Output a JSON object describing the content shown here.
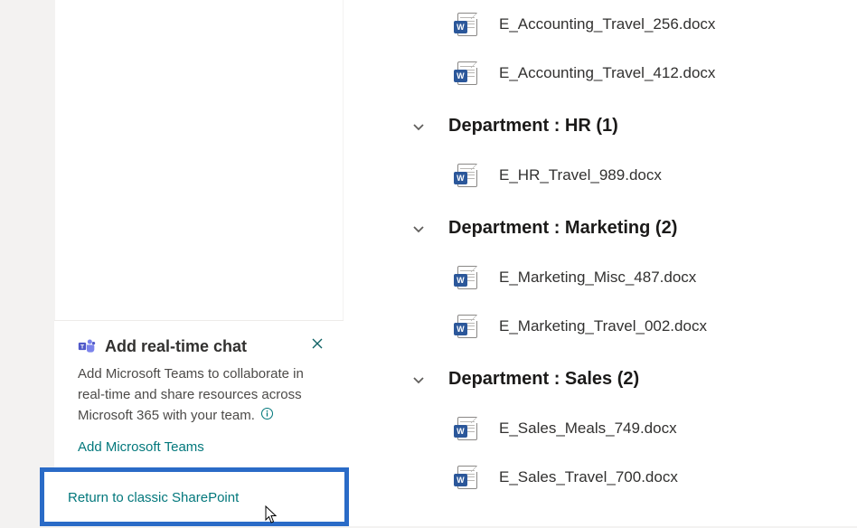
{
  "promo": {
    "title": "Add real-time chat",
    "body": "Add Microsoft Teams to collaborate in real-time and share resources across Microsoft 365 with your team.",
    "link": "Add Microsoft Teams"
  },
  "classic_link": "Return to classic SharePoint",
  "groups": [
    {
      "header": null,
      "files": [
        {
          "name": "E_Accounting_Travel_256.docx"
        },
        {
          "name": "E_Accounting_Travel_412.docx"
        }
      ]
    },
    {
      "header": "Department : HR (1)",
      "files": [
        {
          "name": "E_HR_Travel_989.docx"
        }
      ]
    },
    {
      "header": "Department : Marketing (2)",
      "files": [
        {
          "name": "E_Marketing_Misc_487.docx"
        },
        {
          "name": "E_Marketing_Travel_002.docx"
        }
      ]
    },
    {
      "header": "Department : Sales (2)",
      "files": [
        {
          "name": "E_Sales_Meals_749.docx"
        },
        {
          "name": "E_Sales_Travel_700.docx"
        }
      ]
    }
  ]
}
